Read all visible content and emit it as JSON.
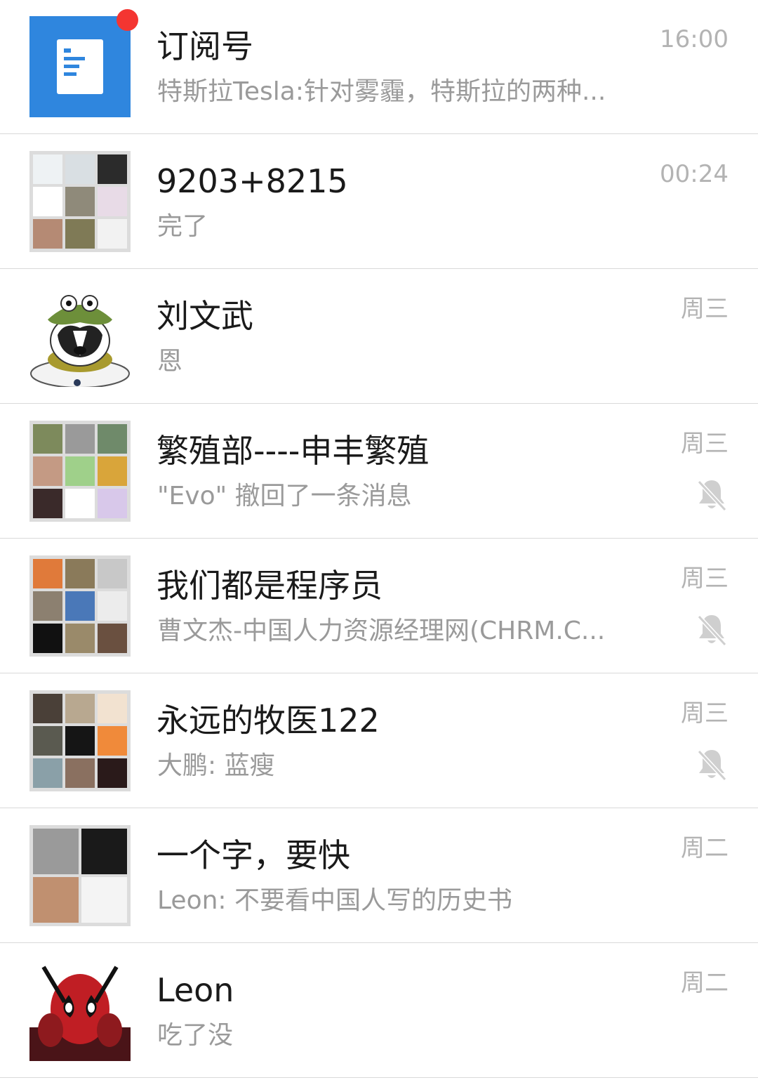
{
  "colors": {
    "name": "#1a1a1a",
    "preview": "#9a9a9a",
    "time": "#b3b3b3",
    "divider": "#d9d9d9",
    "unread_badge": "#f43531",
    "subscription_blue": "#2f86de",
    "mute_icon": "#cfcfcf"
  },
  "chats": [
    {
      "name": "订阅号",
      "preview": "特斯拉Tesla:针对雾霾，特斯拉的两种...",
      "time": "16:00",
      "avatar_icon": "document-list-icon",
      "unread": true,
      "muted": false
    },
    {
      "name": "9203+8215",
      "preview": "完了",
      "time": "00:24",
      "avatar_icon": "group-avatar-grid",
      "unread": false,
      "muted": false
    },
    {
      "name": "刘文武",
      "preview": "恩",
      "time": "周三",
      "avatar_icon": "dog-with-frog-hat-avatar",
      "unread": false,
      "muted": false
    },
    {
      "name": "繁殖部----申丰繁殖",
      "preview": "\"Evo\" 撤回了一条消息",
      "time": "周三",
      "avatar_icon": "group-avatar-grid",
      "unread": false,
      "muted": true
    },
    {
      "name": "我们都是程序员",
      "preview": "曹文杰-中国人力资源经理网(CHRM.C...",
      "time": "周三",
      "avatar_icon": "group-avatar-grid",
      "unread": false,
      "muted": true
    },
    {
      "name": "永远的牧医122",
      "preview": "大鹏: 蓝瘦",
      "time": "周三",
      "avatar_icon": "group-avatar-grid",
      "unread": false,
      "muted": true
    },
    {
      "name": "一个字，要快",
      "preview": "Leon: 不要看中国人写的历史书",
      "time": "周二",
      "avatar_icon": "group-avatar-grid",
      "unread": false,
      "muted": false
    },
    {
      "name": "Leon",
      "preview": "吃了没",
      "time": "周二",
      "avatar_icon": "deadpool-avatar",
      "unread": false,
      "muted": false
    }
  ]
}
